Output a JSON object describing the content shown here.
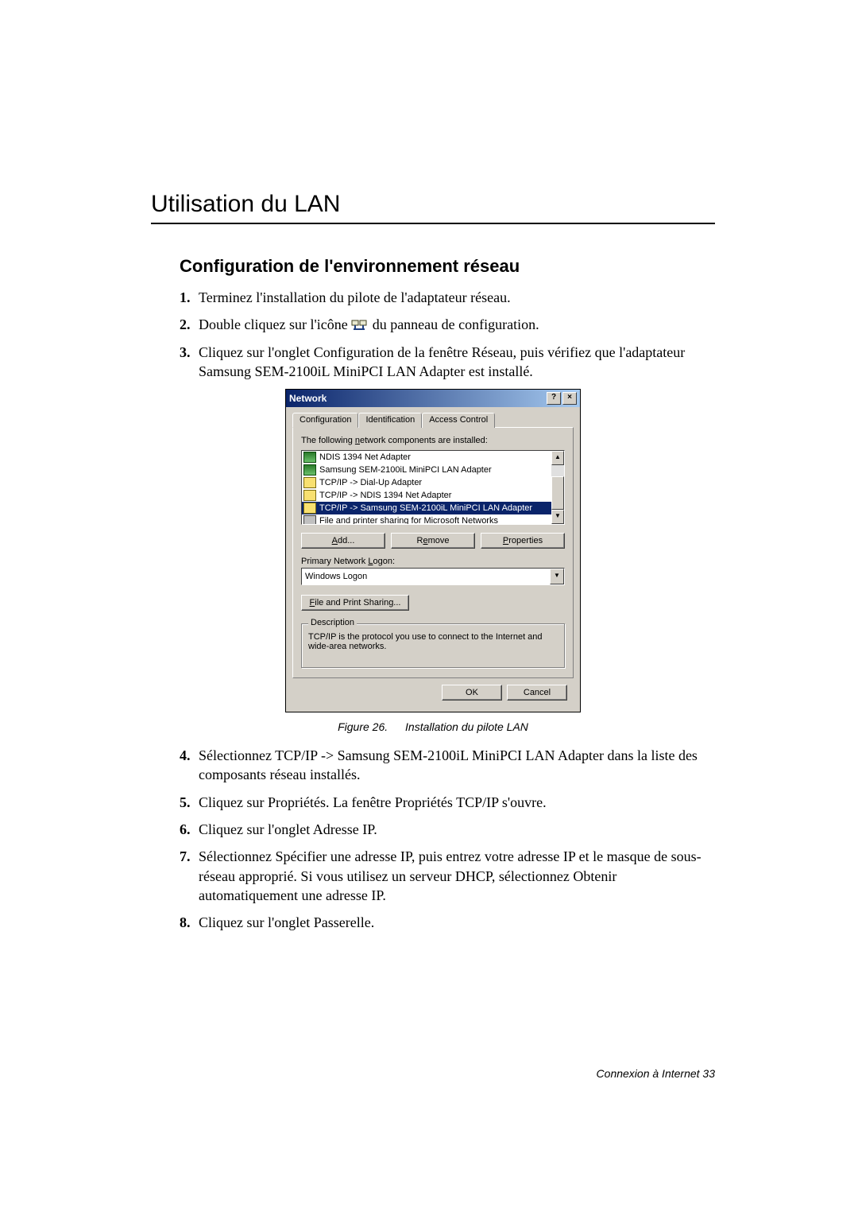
{
  "headings": {
    "h1": "Utilisation du LAN",
    "h2": "Configuration de l'environnement réseau"
  },
  "steps": {
    "s1": {
      "num": "1.",
      "text": "Terminez l'installation du pilote de l'adaptateur réseau."
    },
    "s2": {
      "num": "2.",
      "before": "Double cliquez sur l'icône ",
      "after": " du panneau de configuration."
    },
    "s3": {
      "num": "3.",
      "text": "Cliquez sur l'onglet Configuration de la fenêtre Réseau, puis vérifiez que l'adaptateur Samsung SEM-2100iL MiniPCI LAN Adapter est installé."
    },
    "s4": {
      "num": "4.",
      "text": "Sélectionnez TCP/IP -> Samsung SEM-2100iL MiniPCI LAN Adapter dans la liste des composants réseau installés."
    },
    "s5": {
      "num": "5.",
      "text": "Cliquez sur Propriétés. La fenêtre Propriétés TCP/IP s'ouvre."
    },
    "s6": {
      "num": "6.",
      "text": "Cliquez sur l'onglet Adresse IP."
    },
    "s7": {
      "num": "7.",
      "text": "Sélectionnez Spécifier une adresse IP, puis entrez votre adresse IP et le masque de sous-réseau approprié. Si vous utilisez un serveur DHCP, sélectionnez Obtenir automatiquement une adresse IP."
    },
    "s8": {
      "num": "8.",
      "text": "Cliquez sur l'onglet Passerelle."
    }
  },
  "dialog": {
    "title": "Network",
    "help_btn": "?",
    "close_btn": "×",
    "tabs": {
      "t1": "Configuration",
      "t2": "Identification",
      "t3": "Access Control"
    },
    "installed_label_pre": "The following ",
    "installed_label_u": "n",
    "installed_label_post": "etwork components are installed:",
    "components": {
      "c0": "NDIS 1394 Net Adapter",
      "c1": "Samsung SEM-2100iL MiniPCI LAN Adapter",
      "c2": "TCP/IP -> Dial-Up Adapter",
      "c3": "TCP/IP -> NDIS 1394 Net Adapter",
      "c4": "TCP/IP -> Samsung SEM-2100iL MiniPCI LAN Adapter",
      "c5": "File and printer sharing for Microsoft Networks"
    },
    "buttons": {
      "add_u": "A",
      "add_rest": "dd...",
      "remove_pre": "R",
      "remove_u": "e",
      "remove_post": "move",
      "props_u": "P",
      "props_rest": "roperties",
      "fps_u": "F",
      "fps_rest": "ile and Print Sharing...",
      "ok": "OK",
      "cancel": "Cancel"
    },
    "logon_label_pre": "Primary Network ",
    "logon_label_u": "L",
    "logon_label_post": "ogon:",
    "logon_value": "Windows Logon",
    "desc_legend": "Description",
    "desc_text": "TCP/IP is the protocol you use to connect to the Internet and wide-area networks."
  },
  "caption": {
    "num": "Figure 26.",
    "text": "Installation du pilote LAN"
  },
  "footer": "Connexion à Internet   33"
}
